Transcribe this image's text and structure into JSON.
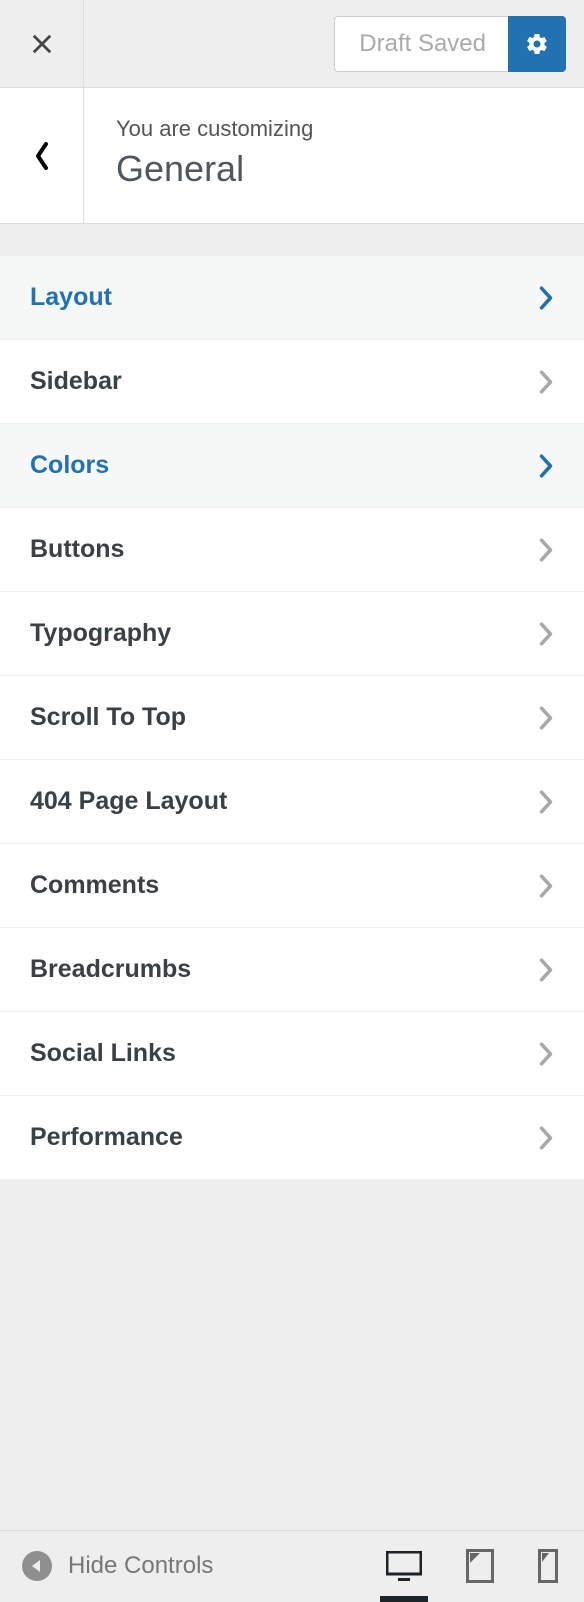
{
  "topbar": {
    "draft_label": "Draft Saved"
  },
  "header": {
    "subtitle": "You are customizing",
    "title": "General"
  },
  "menu": {
    "items": [
      {
        "label": "Layout",
        "active": true
      },
      {
        "label": "Sidebar",
        "active": false
      },
      {
        "label": "Colors",
        "active": true
      },
      {
        "label": "Buttons",
        "active": false
      },
      {
        "label": "Typography",
        "active": false
      },
      {
        "label": "Scroll To Top",
        "active": false
      },
      {
        "label": "404 Page Layout",
        "active": false
      },
      {
        "label": "Comments",
        "active": false
      },
      {
        "label": "Breadcrumbs",
        "active": false
      },
      {
        "label": "Social Links",
        "active": false
      },
      {
        "label": "Performance",
        "active": false
      }
    ]
  },
  "footer": {
    "hide_label": "Hide Controls",
    "devices": [
      {
        "name": "desktop",
        "active": true
      },
      {
        "name": "tablet",
        "active": false
      },
      {
        "name": "mobile",
        "active": false
      }
    ]
  }
}
